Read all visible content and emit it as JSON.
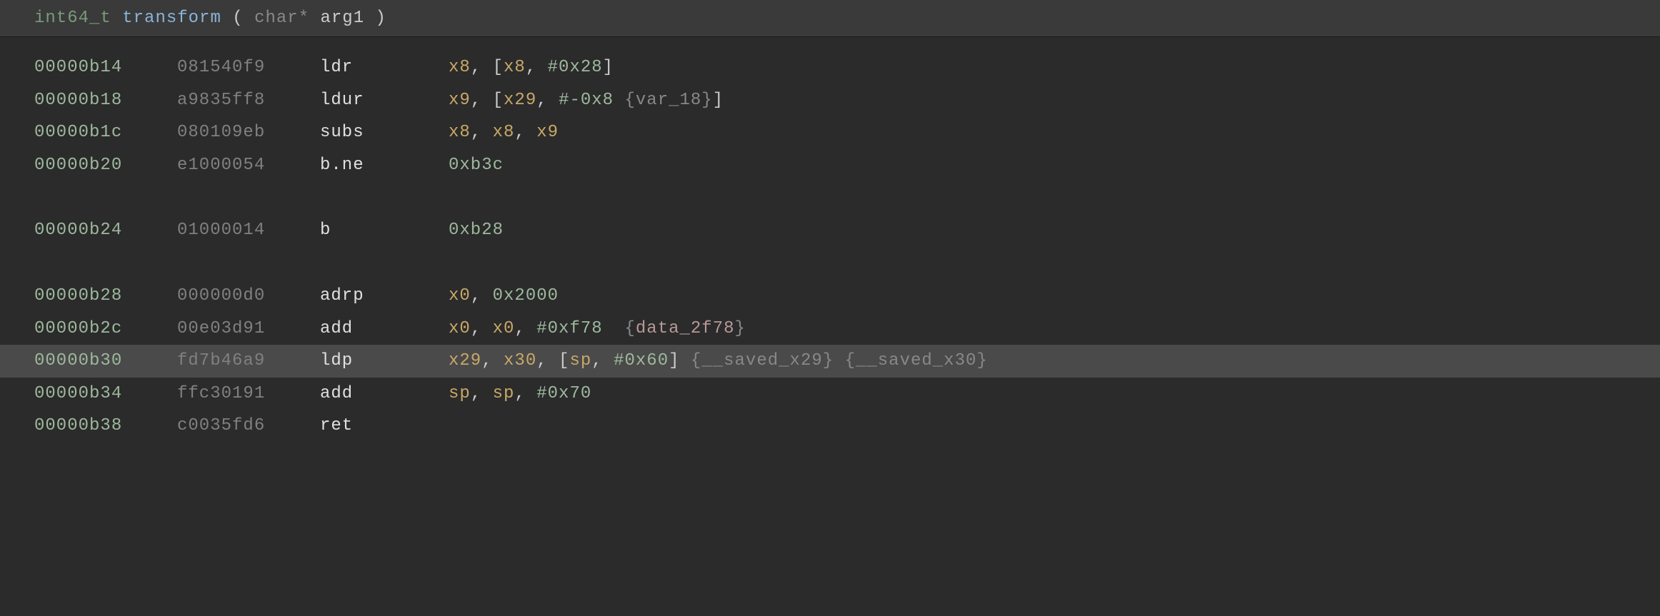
{
  "header": {
    "return_type": "int64_t",
    "function_name": "transform",
    "param_type": "char*",
    "param_name": "arg1"
  },
  "lines": [
    {
      "addr": "00000b14",
      "bytes": "081540f9",
      "mnem": "ldr",
      "ops": [
        {
          "t": "reg",
          "v": "x8"
        },
        {
          "t": "punct",
          "v": ", ["
        },
        {
          "t": "reg",
          "v": "x8"
        },
        {
          "t": "punct",
          "v": ", "
        },
        {
          "t": "num",
          "v": "#0x28"
        },
        {
          "t": "punct",
          "v": "]"
        }
      ]
    },
    {
      "addr": "00000b18",
      "bytes": "a9835ff8",
      "mnem": "ldur",
      "ops": [
        {
          "t": "reg",
          "v": "x9"
        },
        {
          "t": "punct",
          "v": ", ["
        },
        {
          "t": "reg",
          "v": "x29"
        },
        {
          "t": "punct",
          "v": ", "
        },
        {
          "t": "num",
          "v": "#-0x8"
        },
        {
          "t": "punct",
          "v": " "
        },
        {
          "t": "brace-var",
          "v": "{var_18}"
        },
        {
          "t": "punct",
          "v": "]"
        }
      ]
    },
    {
      "addr": "00000b1c",
      "bytes": "080109eb",
      "mnem": "subs",
      "ops": [
        {
          "t": "reg",
          "v": "x8"
        },
        {
          "t": "punct",
          "v": ", "
        },
        {
          "t": "reg",
          "v": "x8"
        },
        {
          "t": "punct",
          "v": ", "
        },
        {
          "t": "reg",
          "v": "x9"
        }
      ]
    },
    {
      "addr": "00000b20",
      "bytes": "e1000054",
      "mnem": "b.ne",
      "ops": [
        {
          "t": "num",
          "v": "0xb3c"
        }
      ]
    },
    {
      "blank": true
    },
    {
      "addr": "00000b24",
      "bytes": "01000014",
      "mnem": "b",
      "ops": [
        {
          "t": "num",
          "v": "0xb28"
        }
      ]
    },
    {
      "blank": true
    },
    {
      "addr": "00000b28",
      "bytes": "000000d0",
      "mnem": "adrp",
      "ops": [
        {
          "t": "reg",
          "v": "x0"
        },
        {
          "t": "punct",
          "v": ", "
        },
        {
          "t": "num",
          "v": "0x2000"
        }
      ]
    },
    {
      "addr": "00000b2c",
      "bytes": "00e03d91",
      "mnem": "add",
      "ops": [
        {
          "t": "reg",
          "v": "x0"
        },
        {
          "t": "punct",
          "v": ", "
        },
        {
          "t": "reg",
          "v": "x0"
        },
        {
          "t": "punct",
          "v": ", "
        },
        {
          "t": "num",
          "v": "#0xf78"
        },
        {
          "t": "punct",
          "v": "  "
        },
        {
          "t": "brace-var",
          "v": "{"
        },
        {
          "t": "data-ref",
          "v": "data_2f78"
        },
        {
          "t": "brace-var",
          "v": "}"
        }
      ]
    },
    {
      "addr": "00000b30",
      "bytes": "fd7b46a9",
      "mnem": "ldp",
      "highlighted": true,
      "ops": [
        {
          "t": "reg",
          "v": "x29"
        },
        {
          "t": "punct",
          "v": ", "
        },
        {
          "t": "reg",
          "v": "x30"
        },
        {
          "t": "punct",
          "v": ", ["
        },
        {
          "t": "reg",
          "v": "sp"
        },
        {
          "t": "punct",
          "v": ", "
        },
        {
          "t": "num",
          "v": "#0x60"
        },
        {
          "t": "punct",
          "v": "] "
        },
        {
          "t": "brace-var",
          "v": "{__saved_x29}"
        },
        {
          "t": "punct",
          "v": " "
        },
        {
          "t": "brace-var",
          "v": "{__saved_x30}"
        }
      ]
    },
    {
      "addr": "00000b34",
      "bytes": "ffc30191",
      "mnem": "add",
      "ops": [
        {
          "t": "reg",
          "v": "sp"
        },
        {
          "t": "punct",
          "v": ", "
        },
        {
          "t": "reg",
          "v": "sp"
        },
        {
          "t": "punct",
          "v": ", "
        },
        {
          "t": "num",
          "v": "#0x70"
        }
      ]
    },
    {
      "addr": "00000b38",
      "bytes": "c0035fd6",
      "mnem": "ret",
      "ops": []
    }
  ]
}
